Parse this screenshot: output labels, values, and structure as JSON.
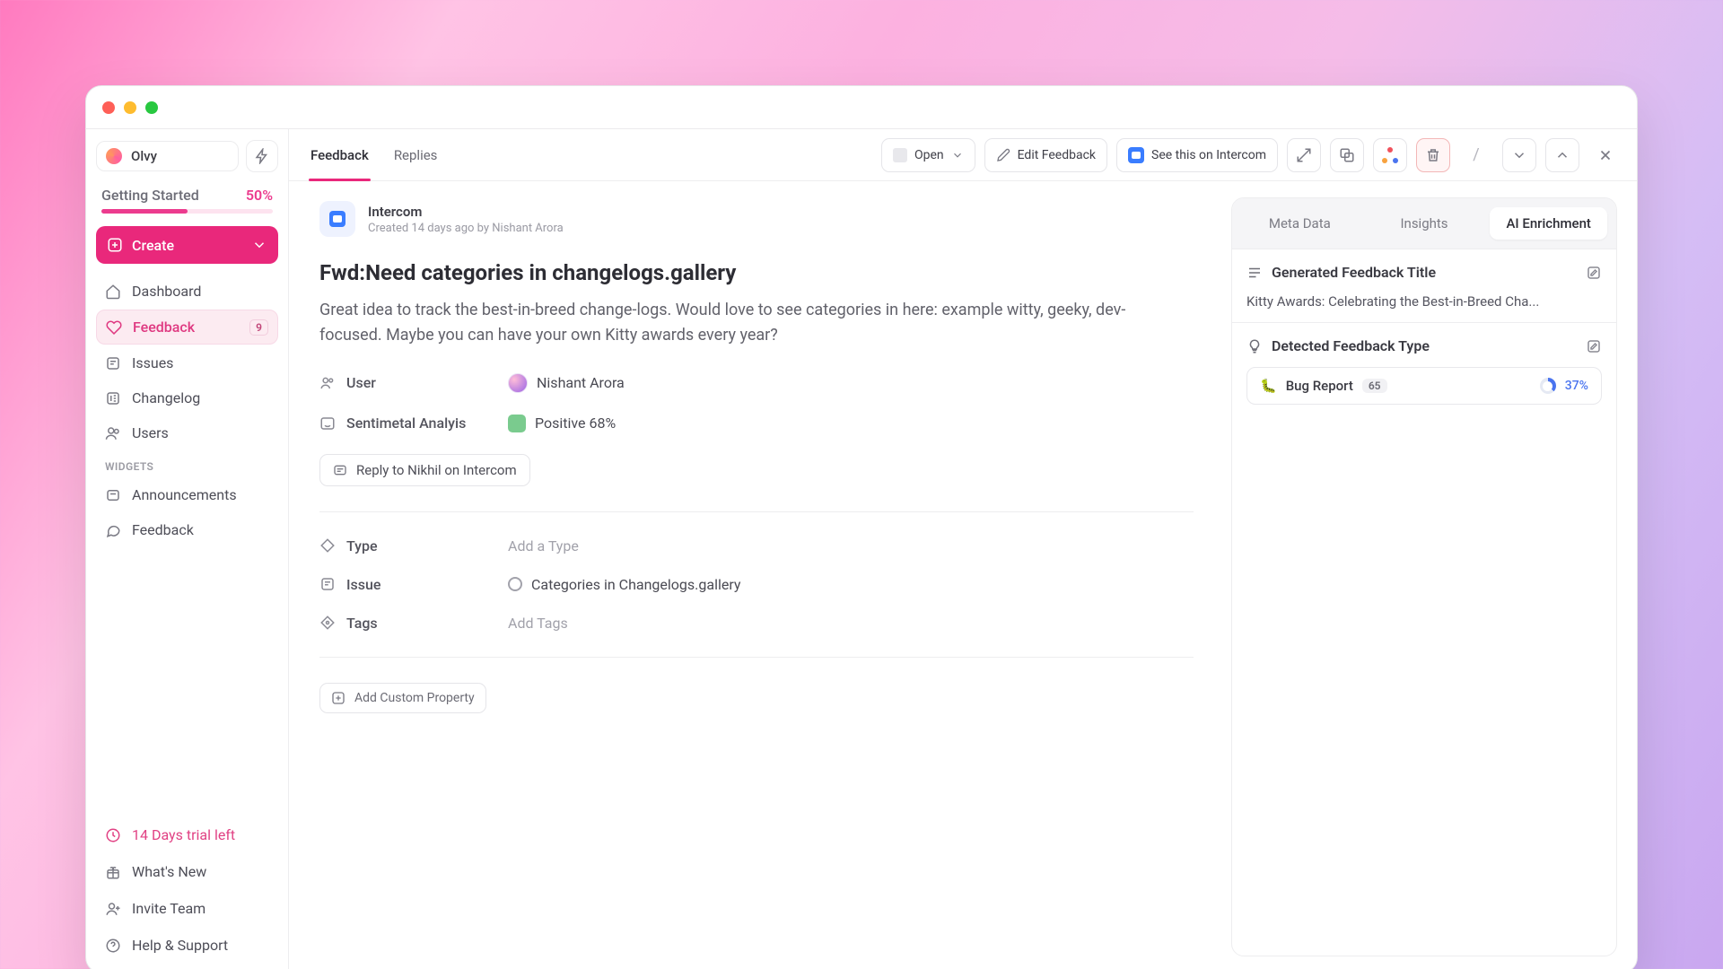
{
  "workspace": {
    "name": "Olvy"
  },
  "sidebar": {
    "gettingStarted": {
      "label": "Getting Started",
      "percent": "50%"
    },
    "create": "Create",
    "items": [
      {
        "label": "Dashboard"
      },
      {
        "label": "Feedback",
        "badge": "9",
        "active": true
      },
      {
        "label": "Issues"
      },
      {
        "label": "Changelog"
      },
      {
        "label": "Users"
      }
    ],
    "widgetsHeading": "WIDGETS",
    "widgets": [
      {
        "label": "Announcements"
      },
      {
        "label": "Feedback"
      }
    ],
    "footer": {
      "trial": "14 Days trial left",
      "whatsnew": "What's New",
      "invite": "Invite Team",
      "help": "Help & Support"
    }
  },
  "toolbar": {
    "tabs": {
      "feedback": "Feedback",
      "replies": "Replies"
    },
    "open": "Open",
    "edit": "Edit Feedback",
    "intercom": "See this on Intercom",
    "slash": "/"
  },
  "feedback": {
    "source": "Intercom",
    "meta": "Created 14 days ago by Nishant Arora",
    "title": "Fwd:Need categories in changelogs.gallery",
    "description": "Great idea to track the best-in-breed change-logs. Would love to see categories in here: example witty, geeky, dev-focused. Maybe you can have your own Kitty awards every year?",
    "userLabel": "User",
    "userValue": "Nishant Arora",
    "sentimentLabel": "Sentimetal Analyis",
    "sentimentValue": "Positive 68%",
    "replyBtn": "Reply to Nikhil on Intercom",
    "typeLabel": "Type",
    "typePlaceholder": "Add a Type",
    "issueLabel": "Issue",
    "issueValue": "Categories in Changelogs.gallery",
    "tagsLabel": "Tags",
    "tagsPlaceholder": "Add Tags",
    "addProp": "Add Custom Property"
  },
  "ai": {
    "tabs": {
      "meta": "Meta Data",
      "insights": "Insights",
      "enrich": "AI Enrichment"
    },
    "genTitleLabel": "Generated Feedback Title",
    "genTitle": "Kitty Awards: Celebrating the Best-in-Breed Cha...",
    "detectedLabel": "Detected Feedback Type",
    "type": {
      "name": "Bug Report",
      "count": "65",
      "percent": "37%"
    }
  }
}
